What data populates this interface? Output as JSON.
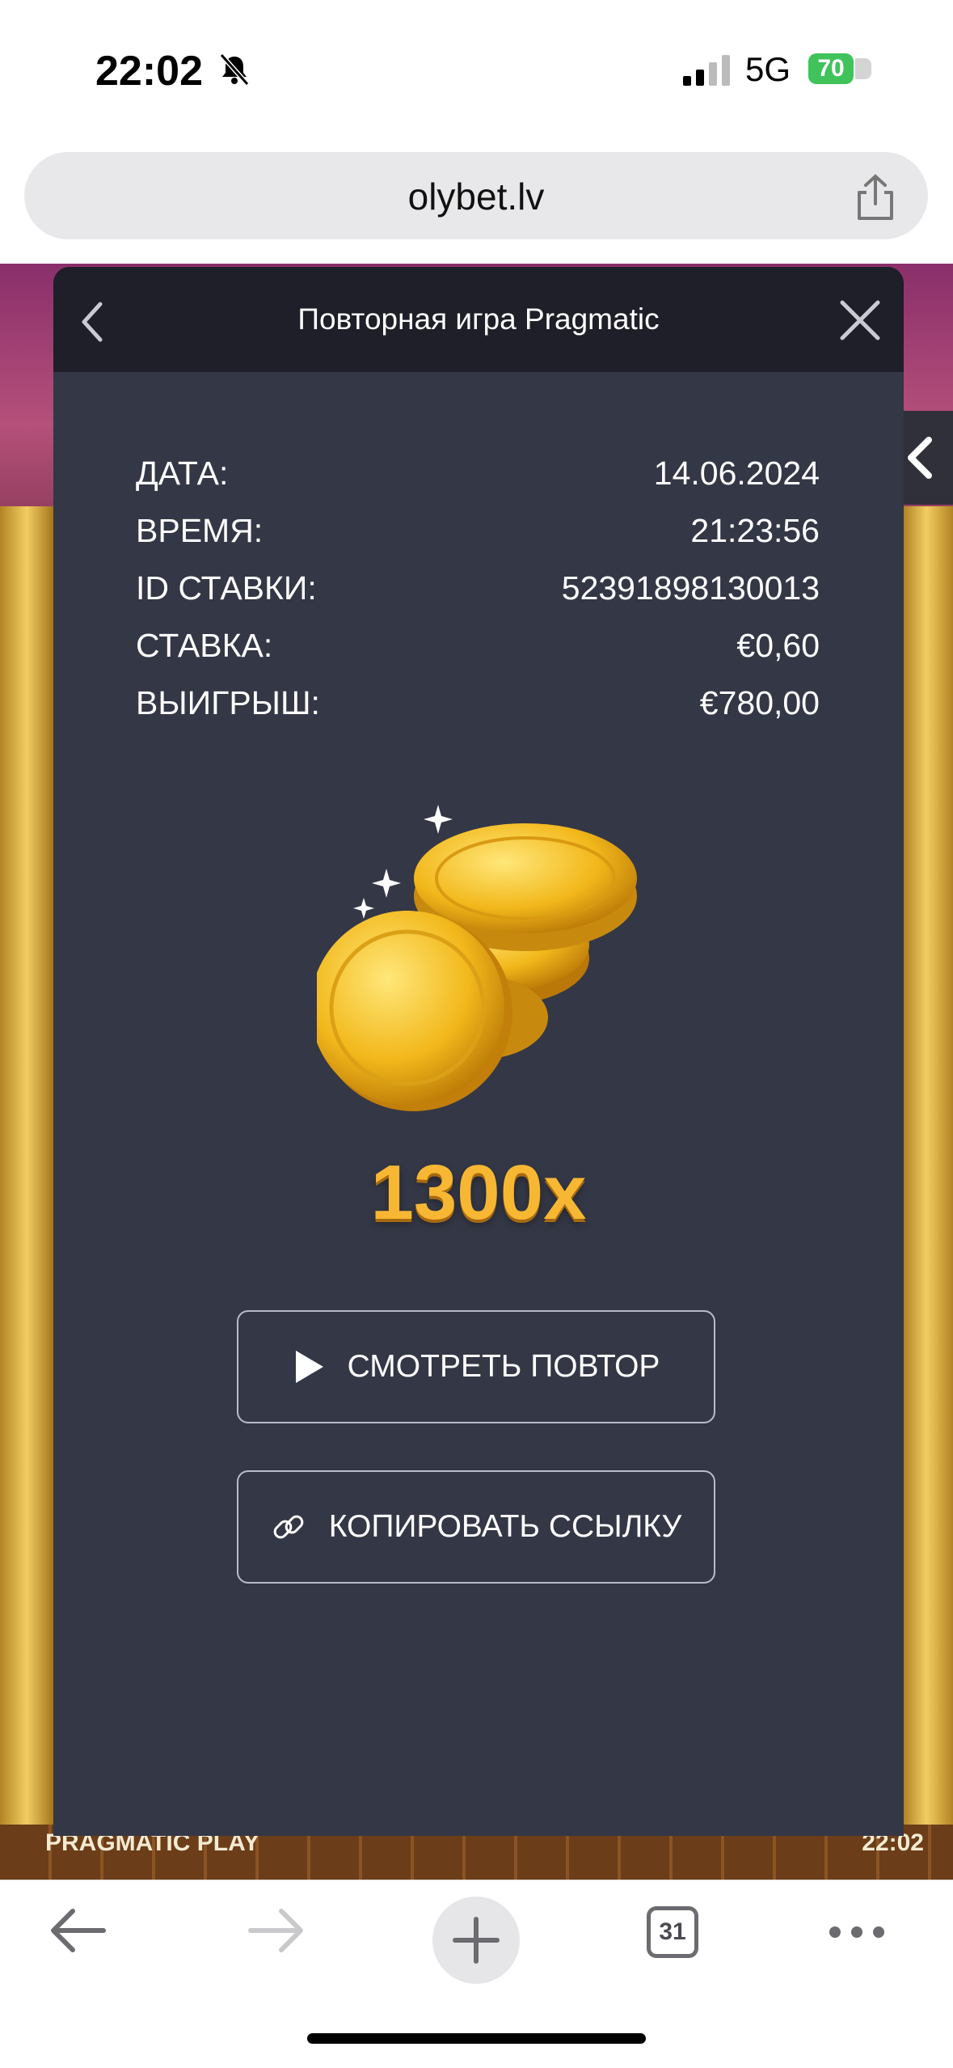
{
  "status_bar": {
    "time": "22:02",
    "network": "5G",
    "battery": "70"
  },
  "browser": {
    "url": "olybet.lv"
  },
  "game": {
    "brand": "PRAGMATIC PLAY",
    "clock": "22:02"
  },
  "modal": {
    "title": "Повторная игра Pragmatic",
    "rows": [
      {
        "label": "ДАТА:",
        "value": "14.06.2024"
      },
      {
        "label": "ВРЕМЯ:",
        "value": "21:23:56"
      },
      {
        "label": "ID СТАВКИ:",
        "value": "52391898130013"
      },
      {
        "label": "СТАВКА:",
        "value": "€0,60"
      },
      {
        "label": "ВЫИГРЫШ:",
        "value": "€780,00"
      }
    ],
    "multiplier": "1300x",
    "watch_label": "СМОТРЕТЬ ПОВТОР",
    "copy_label": "КОПИРОВАТЬ ССЫЛКУ"
  },
  "toolbar": {
    "tab_count": "31"
  },
  "icons": {
    "bell": "bell-slash-icon",
    "share": "share-icon",
    "back": "chevron-left-icon",
    "close": "close-icon",
    "play": "play-icon",
    "link": "link-icon"
  }
}
